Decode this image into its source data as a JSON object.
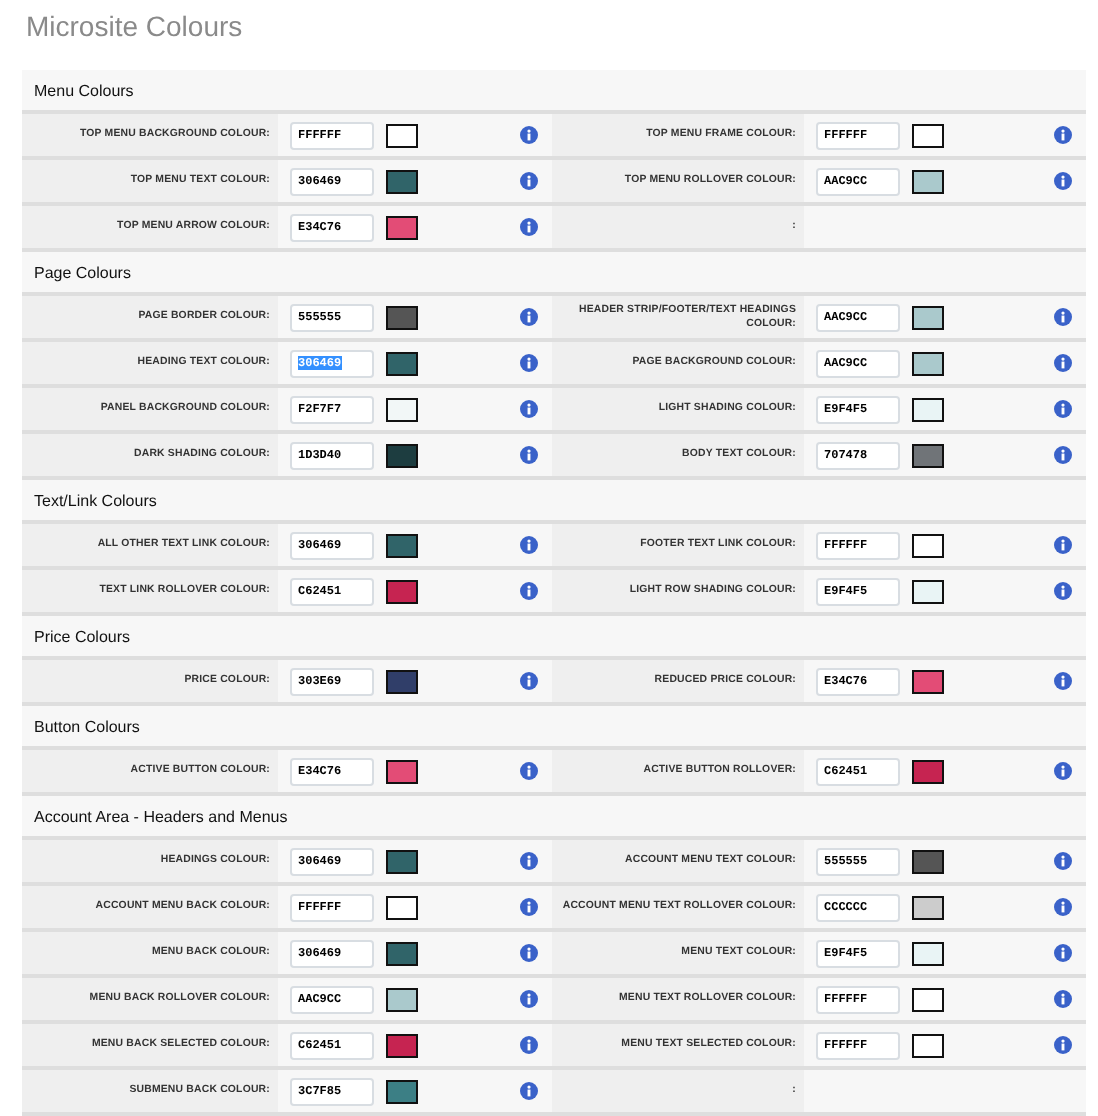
{
  "page_title": "Microsite Colours",
  "sections": [
    {
      "title": "Menu Colours",
      "rows": [
        [
          {
            "kind": "colour",
            "label": "TOP MENU BACKGROUND COLOUR:",
            "value": "FFFFFF",
            "color": "#ffffff",
            "selected": false
          },
          {
            "kind": "colour",
            "label": "TOP MENU FRAME COLOUR:",
            "value": "FFFFFF",
            "color": "#ffffff",
            "selected": false
          }
        ],
        [
          {
            "kind": "colour",
            "label": "TOP MENU TEXT COLOUR:",
            "value": "306469",
            "color": "#306469",
            "selected": false
          },
          {
            "kind": "colour",
            "label": "TOP MENU ROLLOVER COLOUR:",
            "value": "AAC9CC",
            "color": "#aac9cc",
            "selected": false
          }
        ],
        [
          {
            "kind": "colour",
            "label": "TOP MENU ARROW COLOUR:",
            "value": "E34C76",
            "color": "#e34c76",
            "selected": false
          },
          {
            "kind": "blank",
            "label": ":"
          }
        ]
      ]
    },
    {
      "title": "Page Colours",
      "rows": [
        [
          {
            "kind": "colour",
            "label": "PAGE BORDER COLOUR:",
            "value": "555555",
            "color": "#555555",
            "selected": false
          },
          {
            "kind": "colour",
            "label": "HEADER STRIP/FOOTER/TEXT HEADINGS COLOUR:",
            "value": "AAC9CC",
            "color": "#aac9cc",
            "selected": false
          }
        ],
        [
          {
            "kind": "colour",
            "label": "HEADING TEXT COLOUR:",
            "value": "306469",
            "color": "#306469",
            "selected": true
          },
          {
            "kind": "colour",
            "label": "PAGE BACKGROUND COLOUR:",
            "value": "AAC9CC",
            "color": "#aac9cc",
            "selected": false
          }
        ],
        [
          {
            "kind": "colour",
            "label": "PANEL BACKGROUND COLOUR:",
            "value": "F2F7F7",
            "color": "#f2f7f7",
            "selected": false
          },
          {
            "kind": "colour",
            "label": "LIGHT SHADING COLOUR:",
            "value": "E9F4F5",
            "color": "#e9f4f5",
            "selected": false
          }
        ],
        [
          {
            "kind": "colour",
            "label": "DARK SHADING COLOUR:",
            "value": "1D3D40",
            "color": "#1d3d40",
            "selected": false
          },
          {
            "kind": "colour",
            "label": "BODY TEXT COLOUR:",
            "value": "707478",
            "color": "#707478",
            "selected": false
          }
        ]
      ]
    },
    {
      "title": "Text/Link Colours",
      "rows": [
        [
          {
            "kind": "colour",
            "label": "ALL OTHER TEXT LINK COLOUR:",
            "value": "306469",
            "color": "#306469",
            "selected": false
          },
          {
            "kind": "colour",
            "label": "FOOTER TEXT LINK COLOUR:",
            "value": "FFFFFF",
            "color": "#ffffff",
            "selected": false
          }
        ],
        [
          {
            "kind": "colour",
            "label": "TEXT LINK ROLLOVER COLOUR:",
            "value": "C62451",
            "color": "#c62451",
            "selected": false
          },
          {
            "kind": "colour",
            "label": "LIGHT ROW SHADING COLOUR:",
            "value": "E9F4F5",
            "color": "#e9f4f5",
            "selected": false
          }
        ]
      ]
    },
    {
      "title": "Price Colours",
      "rows": [
        [
          {
            "kind": "colour",
            "label": "PRICE COLOUR:",
            "value": "303E69",
            "color": "#303e69",
            "selected": false
          },
          {
            "kind": "colour",
            "label": "REDUCED PRICE COLOUR:",
            "value": "E34C76",
            "color": "#e34c76",
            "selected": false
          }
        ]
      ]
    },
    {
      "title": "Button Colours",
      "rows": [
        [
          {
            "kind": "colour",
            "label": "ACTIVE BUTTON COLOUR:",
            "value": "E34C76",
            "color": "#e34c76",
            "selected": false
          },
          {
            "kind": "colour",
            "label": "ACTIVE BUTTON ROLLOVER:",
            "value": "C62451",
            "color": "#c62451",
            "selected": false
          }
        ]
      ]
    },
    {
      "title": "Account Area - Headers and Menus",
      "rows": [
        [
          {
            "kind": "colour",
            "label": "HEADINGS COLOUR:",
            "value": "306469",
            "color": "#306469",
            "selected": false
          },
          {
            "kind": "colour",
            "label": "ACCOUNT MENU TEXT COLOUR:",
            "value": "555555",
            "color": "#555555",
            "selected": false
          }
        ],
        [
          {
            "kind": "colour",
            "label": "ACCOUNT MENU BACK COLOUR:",
            "value": "FFFFFF",
            "color": "#ffffff",
            "selected": false
          },
          {
            "kind": "colour",
            "label": "ACCOUNT MENU TEXT ROLLOVER COLOUR:",
            "value": "CCCCCC",
            "color": "#cccccc",
            "selected": false
          }
        ],
        [
          {
            "kind": "colour",
            "label": "MENU BACK COLOUR:",
            "value": "306469",
            "color": "#306469",
            "selected": false
          },
          {
            "kind": "colour",
            "label": "MENU TEXT COLOUR:",
            "value": "E9F4F5",
            "color": "#e9f4f5",
            "selected": false
          }
        ],
        [
          {
            "kind": "colour",
            "label": "MENU BACK ROLLOVER COLOUR:",
            "value": "AAC9CC",
            "color": "#aac9cc",
            "selected": false
          },
          {
            "kind": "colour",
            "label": "MENU TEXT ROLLOVER COLOUR:",
            "value": "FFFFFF",
            "color": "#ffffff",
            "selected": false
          }
        ],
        [
          {
            "kind": "colour",
            "label": "MENU BACK SELECTED COLOUR:",
            "value": "C62451",
            "color": "#c62451",
            "selected": false
          },
          {
            "kind": "colour",
            "label": "MENU TEXT SELECTED COLOUR:",
            "value": "FFFFFF",
            "color": "#ffffff",
            "selected": false
          }
        ],
        [
          {
            "kind": "colour",
            "label": "SUBMENU BACK COLOUR:",
            "value": "3C7F85",
            "color": "#3c7f85",
            "selected": false
          },
          {
            "kind": "blank",
            "label": ":"
          }
        ]
      ]
    }
  ]
}
